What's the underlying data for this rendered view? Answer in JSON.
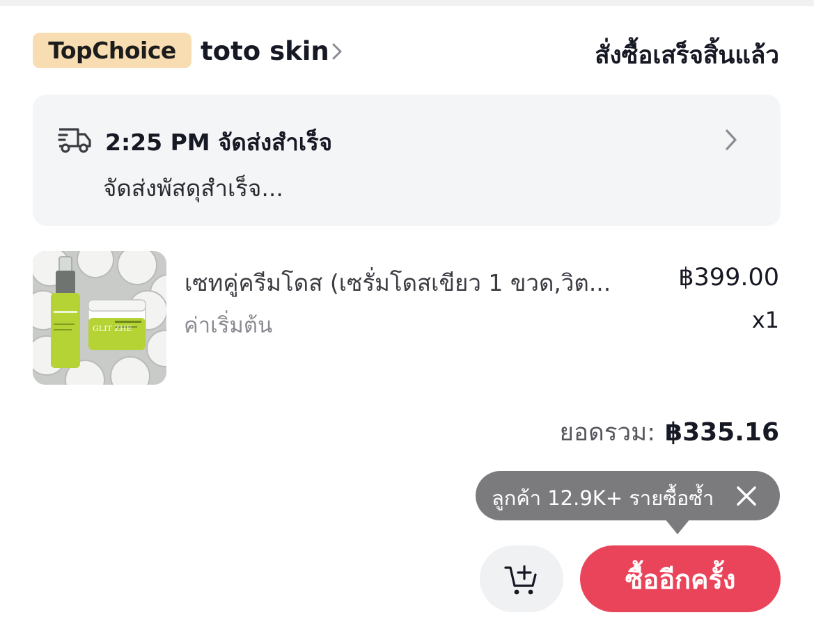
{
  "header": {
    "shop_badge": "TopChoice",
    "shop_name": "toto skin",
    "order_status": "สั่งซื้อเสร็จสิ้นแล้ว"
  },
  "delivery": {
    "time_status": "2:25 PM จัดส่งสำเร็จ",
    "description": "จัดส่งพัสดุสำเร็จ..."
  },
  "product": {
    "title": "เซทคู่ครีมโดส (เซรั่มโดสเขียว 1 ขวด,วิต...",
    "variant": "ค่าเริ่มต้น",
    "price": "฿399.00",
    "quantity": "x1",
    "image_brand_text": "GLIT ZHE"
  },
  "summary": {
    "total_label": "ยอดรวม:",
    "total_value": "฿335.16"
  },
  "tooltip": {
    "text": "ลูกค้า 12.9K+ รายซื้อซ้ำ"
  },
  "actions": {
    "buy_again_label": "ซื้ออีกครั้ง"
  },
  "colors": {
    "badge_bg": "#f7ddb1",
    "primary_button": "#e94459",
    "tooltip_bg": "#7b7b7e",
    "card_bg": "#f4f5f7",
    "product_green": "#b5d334"
  },
  "icons": {
    "shop_chevron": "chevron-right-icon",
    "delivery": "truck-icon",
    "delivery_chevron": "chevron-right-icon",
    "tooltip_close": "close-icon",
    "cart": "add-to-cart-icon"
  }
}
